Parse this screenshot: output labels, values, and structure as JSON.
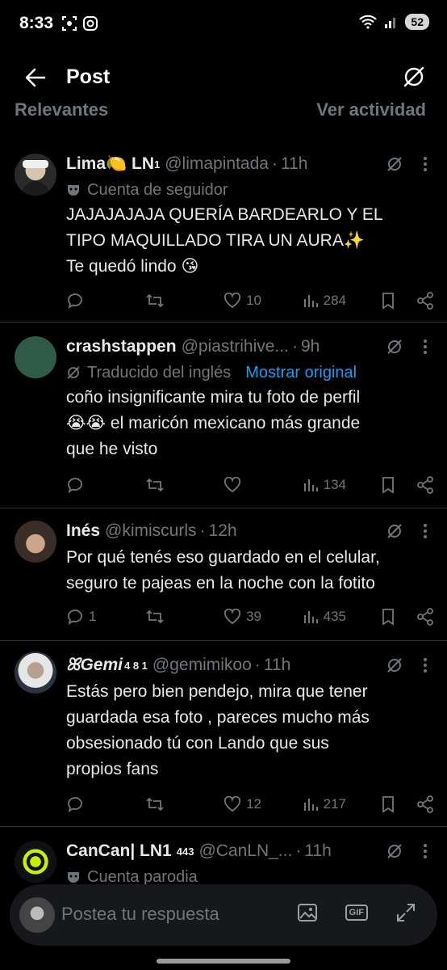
{
  "status_bar": {
    "time": "8:33",
    "battery": "52"
  },
  "header": {
    "title": "Post"
  },
  "cutoff": {
    "left": "Relevantes",
    "right": "Ver actividad"
  },
  "posts": [
    {
      "name": "Lima🍋 LN",
      "name_sup": "1",
      "handle": "@limapintada",
      "time": "11h",
      "meta": "Cuenta de seguidor",
      "meta_link": "",
      "text": "JAJAJAJAJA QUERÍA BARDEARLO Y EL\nTIPO MAQUILLADO TIRA UN AURA✨\nTe quedó lindo 😘",
      "replies": "",
      "reposts": "",
      "likes": "10",
      "views": "284"
    },
    {
      "name": "crashstappen",
      "name_sup": "",
      "handle": "@piastrihive...",
      "time": "9h",
      "meta": "Traducido del inglés",
      "meta_link": "Mostrar original",
      "text": "coño insignificante mira tu foto de perfil\n😭😭 el maricón mexicano más grande\nque he visto",
      "replies": "",
      "reposts": "",
      "likes": "",
      "views": "134"
    },
    {
      "name": "Inés",
      "name_sup": "",
      "handle": "@kimiscurls",
      "time": "12h",
      "meta": "",
      "meta_link": "",
      "text": "Por qué tenés eso guardado en el celular,\nseguro te pajeas en la noche con la fotito",
      "replies": "1",
      "reposts": "",
      "likes": "39",
      "views": "435"
    },
    {
      "name": "ꕤGemi",
      "name_sup": "4 8 1",
      "handle": "@gemimikoo",
      "time": "11h",
      "meta": "",
      "meta_link": "",
      "text": "Estás pero bien pendejo, mira que tener\nguardada esa foto , pareces mucho más\nobsesionado tú con Lando que sus\npropios fans",
      "replies": "",
      "reposts": "",
      "likes": "12",
      "views": "217"
    },
    {
      "name": "CanCan| LN1",
      "name_sup": "443",
      "handle": "@CanLN_...",
      "time": "11h",
      "meta": "Cuenta parodia",
      "meta_link": "",
      "text": ""
    }
  ],
  "compose": {
    "placeholder": "Postea tu respuesta",
    "gif_label": "GIF"
  },
  "colors": {
    "background": "#000000",
    "text": "#e7e9ea",
    "muted": "#71767b",
    "link": "#1d9bf0",
    "divider": "#2f3336"
  }
}
